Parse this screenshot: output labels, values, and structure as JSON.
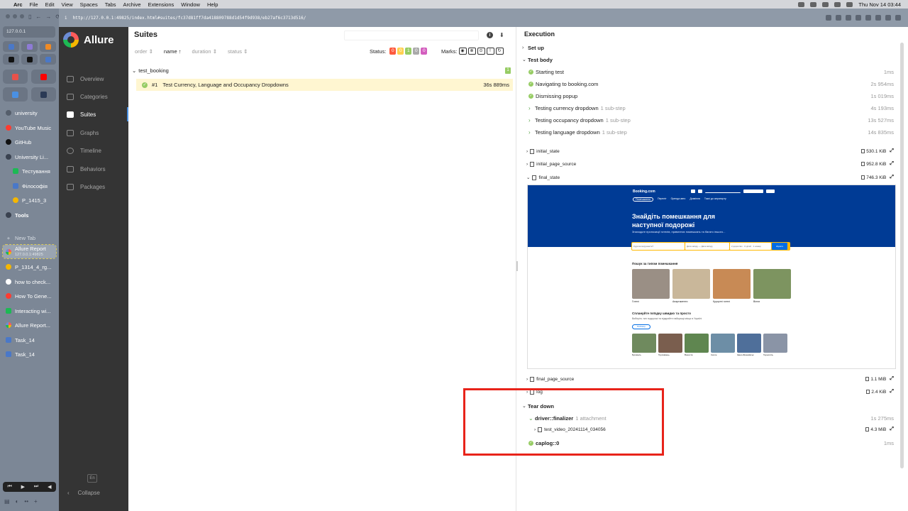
{
  "menubar": {
    "app": "Arc",
    "items": [
      "File",
      "Edit",
      "View",
      "Spaces",
      "Tabs",
      "Archive",
      "Extensions",
      "Window",
      "Help"
    ],
    "clock": "Thu Nov 14  03:44"
  },
  "browser": {
    "url": "http://127.0.0.1:49825/index.html#suites/fc37d81ff7da418809788d1d54f9d938/eb27af6c3713d516/",
    "sidebar_url": "127.0.0.1",
    "tabs": [
      {
        "label": "university",
        "color": "#555e6b",
        "kind": "folder"
      },
      {
        "label": "YouTube Music",
        "color": "#ff3b30",
        "kind": "tab"
      },
      {
        "label": "GitHub",
        "color": "#111111",
        "kind": "tab"
      },
      {
        "label": "University Li...",
        "color": "#3a4250",
        "kind": "folder"
      },
      {
        "label": "Тестування",
        "color": "#1db954",
        "kind": "sub"
      },
      {
        "label": "Філософія",
        "color": "#4a78c8",
        "kind": "sub"
      },
      {
        "label": "P_1415_3",
        "color": "#f5b700",
        "kind": "sub"
      },
      {
        "label": "Tools",
        "color": "#3a4250",
        "kind": "folder"
      }
    ],
    "new_tab": "New Tab",
    "active_tab": {
      "label": "Allure Report",
      "sub": "127.0.0.1:49825"
    },
    "open_tabs": [
      {
        "label": "P_1314_4_rg...",
        "color": "#f5b700"
      },
      {
        "label": "how to check...",
        "color": "#ffffff"
      },
      {
        "label": "How To Gene...",
        "color": "#ff3b30"
      },
      {
        "label": "Interacting wi...",
        "color": "#1db954"
      },
      {
        "label": "Allure Report...",
        "color": "#fc5a5a"
      },
      {
        "label": "Task_14",
        "color": "#4a78c8"
      },
      {
        "label": "Task_14",
        "color": "#4a78c8"
      }
    ]
  },
  "allure": {
    "brand": "Allure",
    "nav": [
      {
        "label": "Overview",
        "icon": "home-icon"
      },
      {
        "label": "Categories",
        "icon": "flag-icon"
      },
      {
        "label": "Suites",
        "icon": "briefcase-icon",
        "active": true
      },
      {
        "label": "Graphs",
        "icon": "bar-chart-icon"
      },
      {
        "label": "Timeline",
        "icon": "clock-icon"
      },
      {
        "label": "Behaviors",
        "icon": "list-icon"
      },
      {
        "label": "Packages",
        "icon": "package-icon"
      }
    ],
    "lang": "En",
    "collapse": "Collapse"
  },
  "suites": {
    "title": "Suites",
    "sort": {
      "order": "order",
      "name": "name",
      "duration": "duration",
      "status": "status"
    },
    "status_label": "Status:",
    "status_counts": [
      {
        "value": "0",
        "color": "#fd5a3e"
      },
      {
        "value": "0",
        "color": "#ffd050"
      },
      {
        "value": "1",
        "color": "#97cc64"
      },
      {
        "value": "0",
        "color": "#aaaaaa"
      },
      {
        "value": "0",
        "color": "#d35ebe"
      }
    ],
    "marks_label": "Marks:",
    "group": {
      "name": "test_booking",
      "count": "1"
    },
    "test": {
      "index": "#1",
      "name": "Test Currency, Language and Occupancy Dropdowns",
      "duration": "36s 889ms"
    }
  },
  "execution": {
    "title": "Execution",
    "setup": "Set up",
    "body": "Test body",
    "steps": [
      {
        "name": "Starting test",
        "time": "1ms",
        "type": "check"
      },
      {
        "name": "Navigating to booking.com",
        "time": "2s 954ms",
        "type": "check"
      },
      {
        "name": "Dismissing popup",
        "time": "1s 019ms",
        "type": "check"
      },
      {
        "name": "Testing currency dropdown",
        "sub": "1 sub-step",
        "time": "4s 193ms",
        "type": "expand"
      },
      {
        "name": "Testing occupancy dropdown",
        "sub": "1 sub-step",
        "time": "13s 527ms",
        "type": "expand"
      },
      {
        "name": "Testing language dropdown",
        "sub": "1 sub-step",
        "time": "14s 835ms",
        "type": "expand"
      }
    ],
    "attachments": [
      {
        "name": "initial_state",
        "size": "530.1 KiB"
      },
      {
        "name": "initial_page_source",
        "size": "952.8 KiB"
      },
      {
        "name": "final_state",
        "size": "746.3 KiB",
        "open": true
      }
    ],
    "attachments_after": [
      {
        "name": "final_page_source",
        "size": "1.1 MiB"
      },
      {
        "name": "log",
        "size": "2.4 KiB"
      }
    ],
    "teardown": "Tear down",
    "finalizer": {
      "name": "driver::finalizer",
      "sub": "1 attachment",
      "time": "1s 275ms"
    },
    "video": {
      "name": "test_video_20241114_034056",
      "size": "4.3 MiB"
    },
    "caplog": {
      "name": "caplog::0",
      "time": "1ms"
    }
  },
  "screenshot": {
    "logo": "Booking.com",
    "tabs": [
      "Помешкання",
      "Переліт",
      "Оренда авто",
      "Дозвілля",
      "Таксі до аеропорту"
    ],
    "headline": "Знайдіть помешкання для наступної подорожі",
    "lead": "Знаходьте пропозиції готелів, приватних помешкань та багато іншого...",
    "search_fields": [
      "Куди ви вирушаєте?",
      "Дата заїзду — Дата виїзду",
      "2 дорослих · 0 дітей · 1 номер"
    ],
    "search_button": "Шукати",
    "section1": "Пошук за типом помешкання",
    "types": [
      {
        "label": "Готелі",
        "color": "#9a8f85"
      },
      {
        "label": "Апартаменти",
        "color": "#c9b79a"
      },
      {
        "label": "Курортні готелі",
        "color": "#c88a55"
      },
      {
        "label": "Вілли",
        "color": "#7d9460"
      }
    ],
    "section2": "Сплануйте поїздку швидко та просто",
    "section2_sub": "Виберіть тип подорожі та відкрийте найкращі місця в Україні",
    "pill": "Поблизу",
    "cities": [
      {
        "label": "Буковель",
        "color": "#6f8a5e"
      },
      {
        "label": "Трускавець",
        "color": "#7a5e4e"
      },
      {
        "label": "Ворохта",
        "color": "#5f8650"
      },
      {
        "label": "Сколе",
        "color": "#6d8ea6"
      },
      {
        "label": "Івано-Франківськ",
        "color": "#4f6f9a"
      },
      {
        "label": "Тернопіль",
        "color": "#8a94a6"
      }
    ]
  }
}
